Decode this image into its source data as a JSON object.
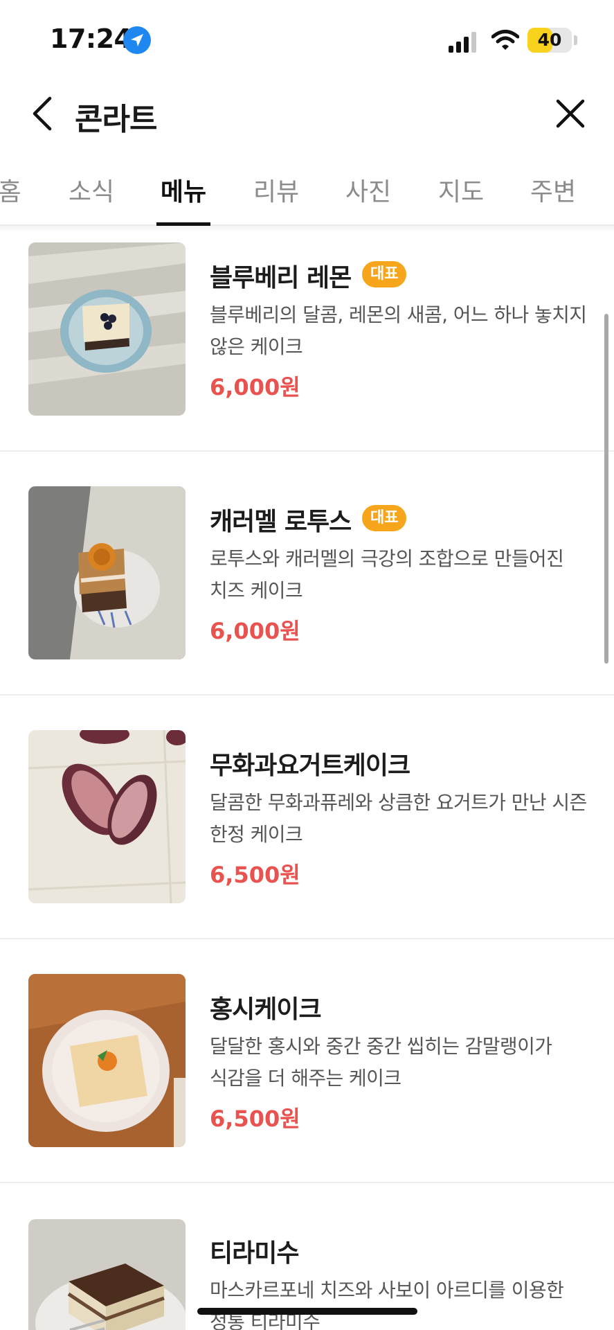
{
  "status_bar": {
    "time": "17:24",
    "battery_level": "40",
    "icons": [
      "location-arrow-icon",
      "signal-icon",
      "wifi-icon",
      "battery-icon"
    ]
  },
  "header": {
    "title": "콘라트",
    "back_icon": "chevron-left-icon",
    "close_icon": "close-icon"
  },
  "tabs": [
    {
      "label": "홈",
      "active": false
    },
    {
      "label": "소식",
      "active": false
    },
    {
      "label": "메뉴",
      "active": true
    },
    {
      "label": "리뷰",
      "active": false
    },
    {
      "label": "사진",
      "active": false
    },
    {
      "label": "지도",
      "active": false
    },
    {
      "label": "주변",
      "active": false
    }
  ],
  "menu": [
    {
      "name": "블루베리 레몬",
      "badge": "대표",
      "description": "블루베리의 달콤, 레몬의 새콤, 어느 하나 놓치지 않은 케이크",
      "price": "6,000원"
    },
    {
      "name": "캐러멜 로투스",
      "badge": "대표",
      "description": "로투스와 캐러멜의 극강의 조합으로 만들어진 치즈 케이크",
      "price": "6,000원"
    },
    {
      "name": "무화과요거트케이크",
      "badge": null,
      "description": "달콤한 무화과퓨레와 상큼한 요거트가 만난 시즌 한정 케이크",
      "price": "6,500원"
    },
    {
      "name": "홍시케이크",
      "badge": null,
      "description": "달달한 홍시와 중간 중간 씹히는 감말랭이가 식감을 더 해주는 케이크",
      "price": "6,500원"
    },
    {
      "name": "티라미수",
      "badge": null,
      "description": "마스카르포네 치즈와 사보이 아르디를 이용한 정통 티라미수",
      "price": ""
    }
  ],
  "colors": {
    "accent_price": "#e8534f",
    "badge": "#f7a51a",
    "battery": "#f8d21c",
    "location": "#1e88f0"
  }
}
